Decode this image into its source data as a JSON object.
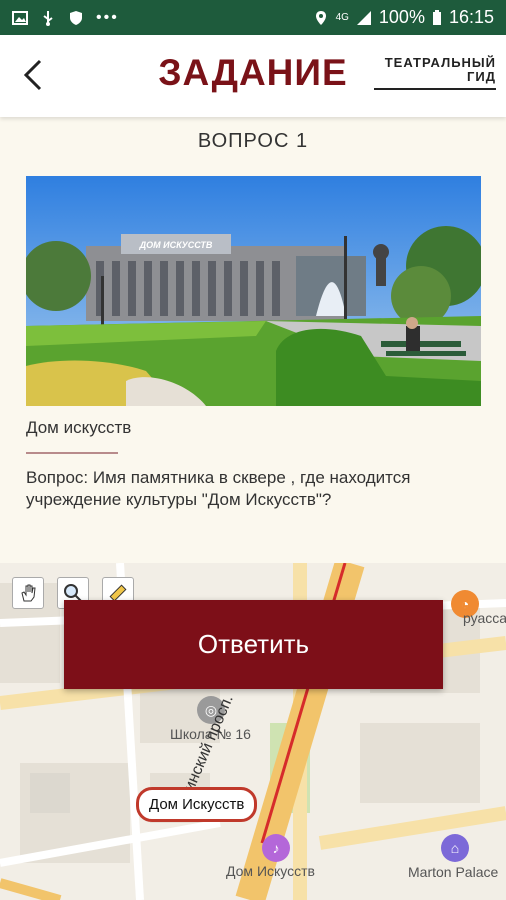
{
  "status_bar": {
    "network": "4G",
    "battery": "100%",
    "time": "16:15",
    "icons": [
      "image-icon",
      "usb-icon",
      "shield-icon",
      "more-icon",
      "location-icon",
      "signal-icon",
      "battery-icon"
    ]
  },
  "header": {
    "title": "ЗАДАНИЕ",
    "guide_line1": "ТЕАТРАЛЬНЫЙ",
    "guide_line2": "ГИД",
    "back_icon": "chevron-left-icon"
  },
  "question": {
    "number_label": "ВОПРОС 1",
    "photo_sign": "ДОМ ИСКУССТВ",
    "caption": "Дом искусств",
    "text": "Вопрос: Имя памятника в сквере , где находится учреждение культуры \"Дом Искусств\"?"
  },
  "map": {
    "answer_button": "Ответить",
    "tools": [
      "hand-icon",
      "zoom-icon",
      "ruler-icon"
    ],
    "labels": {
      "school": "Школа № 16",
      "street": "Ленинский просп.",
      "croissant": "руассан",
      "poi_dom": "Дом Искусств",
      "hotel": "Marton Palace",
      "callout": "Дом Искусств"
    }
  },
  "colors": {
    "brand": "#7a1218",
    "button": "#7d0f18",
    "status_bar": "#1e5b3c",
    "background": "#fbf8ee"
  }
}
